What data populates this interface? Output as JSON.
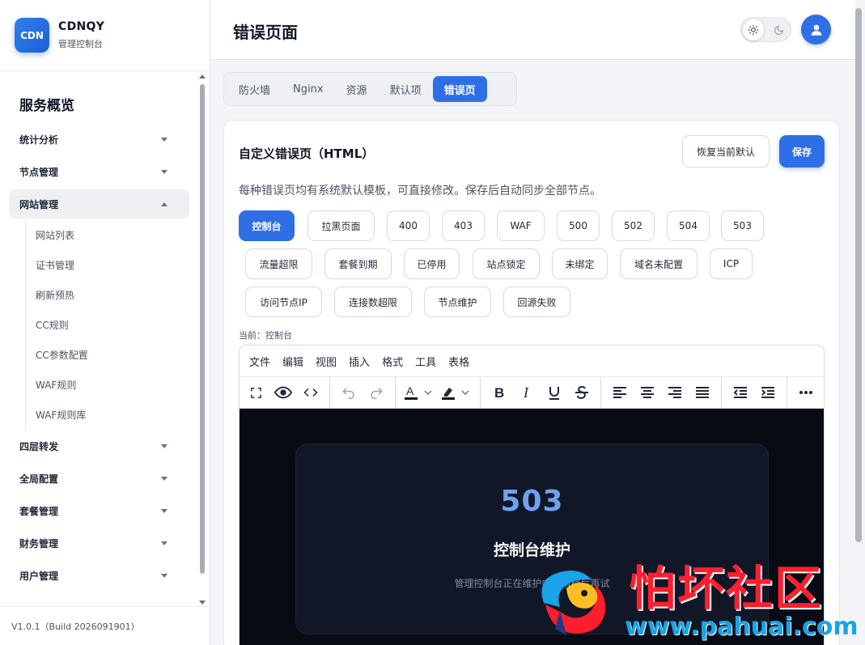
{
  "brand": {
    "logo_text": "CDN",
    "name": "CDNQY",
    "subtitle": "管理控制台"
  },
  "sidebar": {
    "section_title": "服务概览",
    "groups": [
      {
        "label": "统计分析",
        "expanded": false
      },
      {
        "label": "节点管理",
        "expanded": false
      },
      {
        "label": "网站管理",
        "expanded": true,
        "items": [
          "网站列表",
          "证书管理",
          "刷新预热",
          "CC规则",
          "CC参数配置",
          "WAF规则",
          "WAF规则库"
        ]
      },
      {
        "label": "四层转发",
        "expanded": false
      },
      {
        "label": "全局配置",
        "expanded": false
      },
      {
        "label": "套餐管理",
        "expanded": false
      },
      {
        "label": "财务管理",
        "expanded": false
      },
      {
        "label": "用户管理",
        "expanded": false
      }
    ],
    "version": "V1.0.1（Build 2026091901）"
  },
  "header": {
    "title": "错误页面",
    "theme_icons": [
      "sun-icon",
      "moon-icon"
    ],
    "avatar_icon": "user-icon"
  },
  "tabs": [
    "防火墙",
    "Nginx",
    "资源",
    "默认项",
    "错误页"
  ],
  "active_tab": "错误页",
  "card": {
    "title": "自定义错误页（HTML）",
    "restore_button": "恢复当前默认",
    "save_button": "保存",
    "description": "每种错误页均有系统默认模板，可直接修改。保存后自动同步全部节点。",
    "chips": [
      "控制台",
      "拉黑页面",
      "400",
      "403",
      "WAF",
      "500",
      "502",
      "504",
      "503",
      "流量超限",
      "套餐到期",
      "已停用",
      "站点锁定",
      "未绑定",
      "域名未配置",
      "ICP",
      "访问节点IP",
      "连接数超限",
      "节点维护",
      "回源失败"
    ],
    "active_chip": "控制台",
    "current_label": "当前：控制台"
  },
  "editor": {
    "menus": [
      "文件",
      "编辑",
      "视图",
      "插入",
      "格式",
      "工具",
      "表格"
    ],
    "toolbar_icons": [
      "fullscreen-icon",
      "preview-icon",
      "code-icon",
      "undo-icon",
      "redo-icon",
      "text-color-icon",
      "highlight-icon",
      "bold-icon",
      "italic-icon",
      "underline-icon",
      "strikethrough-icon",
      "align-left-icon",
      "align-center-icon",
      "align-right-icon",
      "align-justify-icon",
      "outdent-icon",
      "indent-icon",
      "more-icon"
    ],
    "preview": {
      "code": "503",
      "title": "控制台维护",
      "description": "管理控制台正在维护中，请稍后再试"
    }
  },
  "watermark": {
    "text": "怕坏社区",
    "url": "www.pahuai.com"
  },
  "colors": {
    "accent": "#2f6fe6",
    "preview_bg": "#070b13",
    "preview_code": "#6ea2ee",
    "watermark_red": "#ff1e2d",
    "watermark_blue": "#1aa3e8"
  }
}
